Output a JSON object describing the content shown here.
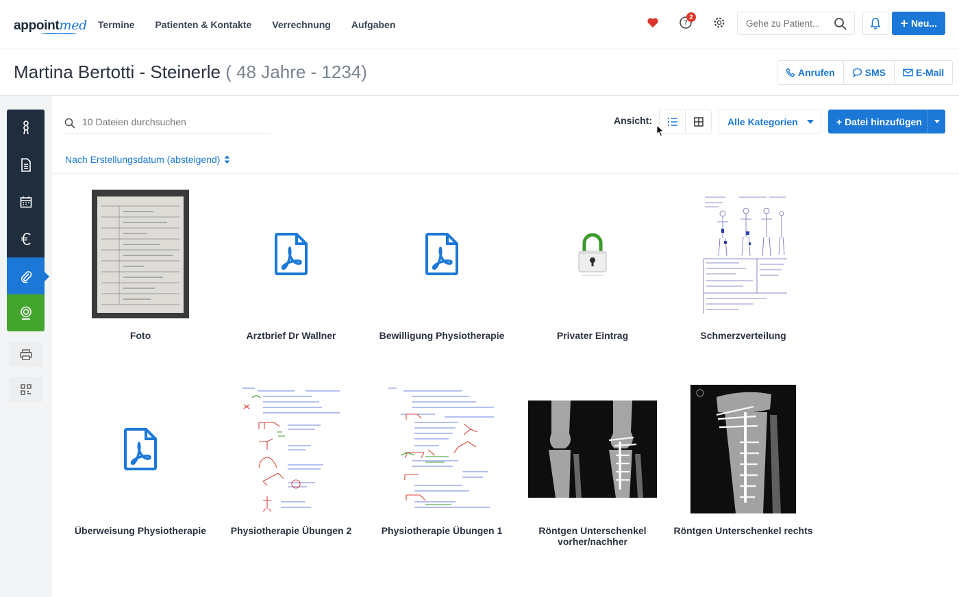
{
  "nav": {
    "logo_main": "appoint",
    "logo_accent": "med",
    "items": [
      "Termine",
      "Patienten & Kontakte",
      "Verrechnung",
      "Aufgaben"
    ],
    "help_badge": "2",
    "search_placeholder": "Gehe zu Patient...",
    "new_button": "Neu..."
  },
  "patient": {
    "name": "Martina Bertotti - Steinerle",
    "meta": "( 48 Jahre - 1234)",
    "actions": {
      "call": "Anrufen",
      "sms": "SMS",
      "email": "E-Mail"
    }
  },
  "sidebar": {
    "items": [
      "patient-icon",
      "document-icon",
      "calendar-icon",
      "euro-icon",
      "paperclip-icon",
      "webcam-icon"
    ],
    "extra": [
      "printer-icon",
      "qr-code-icon"
    ]
  },
  "files": {
    "search_placeholder": "10 Dateien durchsuchen",
    "view_label": "Ansicht:",
    "category_select": "Alle Kategorien",
    "add_button": "+ Datei hinzufügen",
    "sort_label": "Nach Erstellungsdatum (absteigend)",
    "items": [
      {
        "caption": "Foto",
        "kind": "photo"
      },
      {
        "caption": "Arztbrief Dr Wallner",
        "kind": "pdf"
      },
      {
        "caption": "Bewilligung Physiotherapie",
        "kind": "pdf"
      },
      {
        "caption": "Privater Eintrag",
        "kind": "locked"
      },
      {
        "caption": "Schmerzverteilung",
        "kind": "drawing"
      },
      {
        "caption": "Überweisung Physiotherapie",
        "kind": "pdf"
      },
      {
        "caption": "Physiotherapie Übungen 2",
        "kind": "drawing"
      },
      {
        "caption": "Physiotherapie Übungen 1",
        "kind": "drawing"
      },
      {
        "caption": "Röntgen Unterschenkel vorher/nachher",
        "kind": "xray"
      },
      {
        "caption": "Röntgen Unterschenkel rechts",
        "kind": "xray"
      }
    ]
  },
  "colors": {
    "primary": "#1c78d6",
    "sidebar": "#1f2d3d",
    "active_green": "#44a52e",
    "heart": "#d9352b"
  }
}
